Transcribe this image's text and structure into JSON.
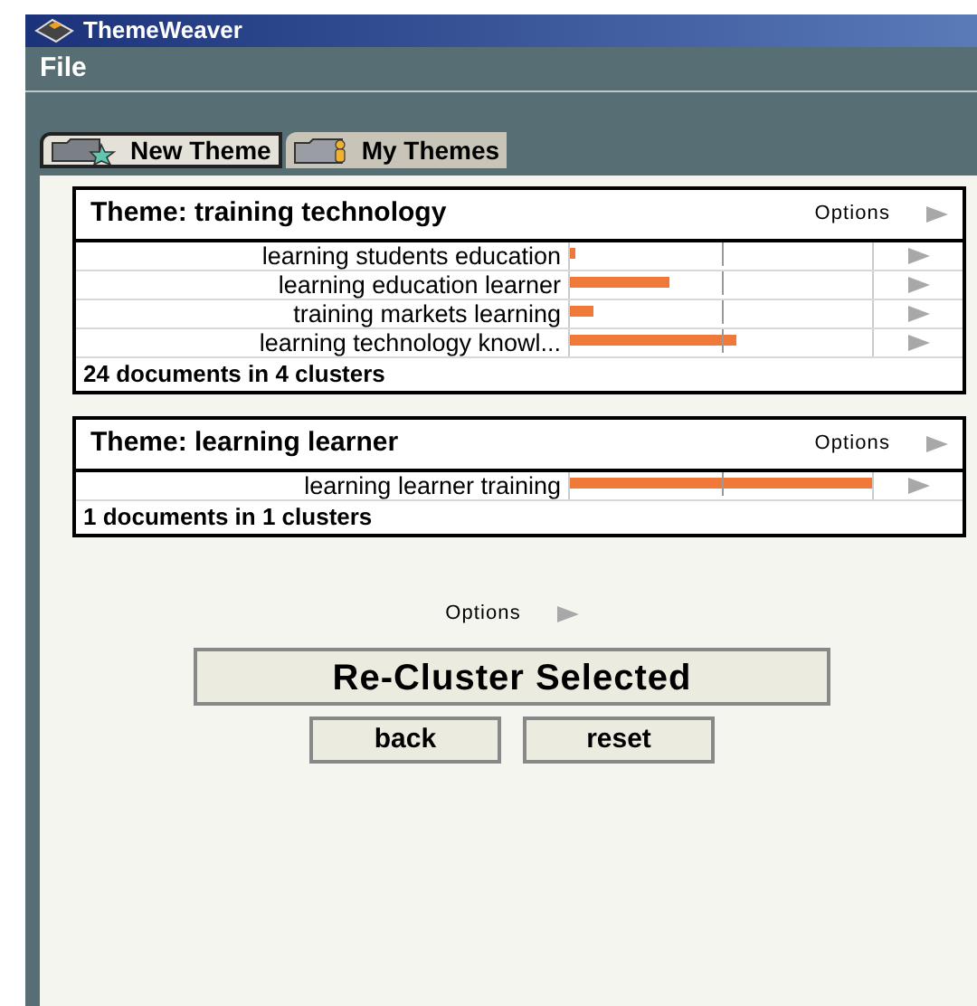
{
  "window": {
    "title": "ThemeWeaver"
  },
  "menu": [
    "File"
  ],
  "tabs": [
    {
      "label": "New Theme",
      "selected": true,
      "kind": "new"
    },
    {
      "label": "My Themes",
      "selected": false,
      "kind": "folder"
    }
  ],
  "themes": [
    {
      "title": "Theme: training technology",
      "options": "Options",
      "clusters": [
        {
          "label": "learning students education",
          "level": 0.02
        },
        {
          "label": "learning education learner",
          "level": 0.33
        },
        {
          "label": "training markets learning",
          "level": 0.08
        },
        {
          "label": "learning technology knowl...",
          "level": 0.55
        }
      ],
      "summary": "24 documents in 4 clusters"
    },
    {
      "title": "Theme: learning learner",
      "options": "Options",
      "clusters": [
        {
          "label": "learning learner training",
          "level": 1.0
        }
      ],
      "summary": "1 documents in 1 clusters"
    }
  ],
  "options": "Options",
  "primary_button": "Re-Cluster Selected",
  "buttons": [
    "back",
    "reset"
  ]
}
